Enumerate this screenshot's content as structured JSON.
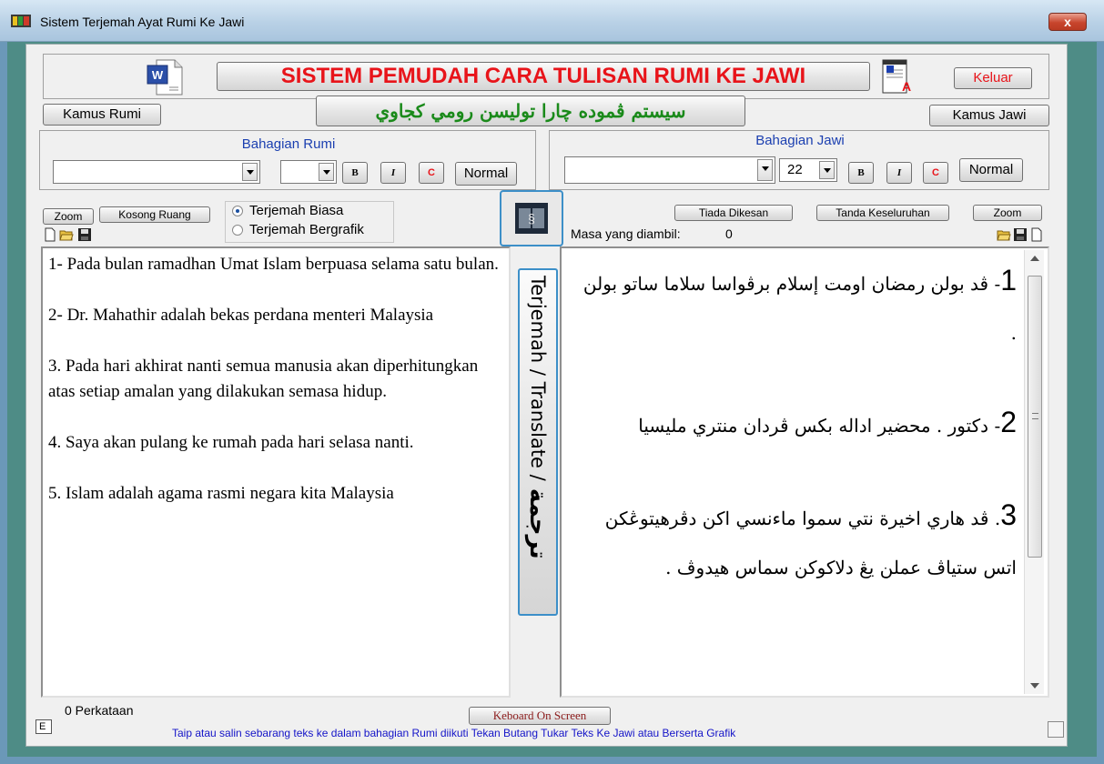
{
  "window": {
    "title": "Sistem Terjemah Ayat Rumi Ke Jawi",
    "close": "x"
  },
  "header": {
    "main_title": "SISTEM PEMUDAH CARA TULISAN RUMI KE JAWI",
    "jawi_title": "سيستم ڤموده چارا توليسن رومي كجاوي",
    "exit_button": "Keluar",
    "kamus_rumi": "Kamus Rumi",
    "kamus_jawi": "Kamus Jawi"
  },
  "rumi_panel": {
    "label": "Bahagian Rumi",
    "font_value": "",
    "size_value": "",
    "bold": "B",
    "italic": "I",
    "color": "C",
    "normal": "Normal"
  },
  "jawi_panel": {
    "label": "Bahagian Jawi",
    "font_value": "",
    "size_value": "22",
    "bold": "B",
    "italic": "I",
    "color": "C",
    "normal": "Normal"
  },
  "left_controls": {
    "zoom": "Zoom",
    "kosong": "Kosong Ruang",
    "radio_biasa": "Terjemah Biasa",
    "radio_grafik": "Terjemah Bergrafik",
    "selected": "biasa"
  },
  "right_controls": {
    "tiada": "Tiada Dikesan",
    "tanda": "Tanda Keseluruhan",
    "zoom": "Zoom",
    "masa_label": "Masa yang diambil:",
    "masa_value": "0"
  },
  "translate_button": {
    "latin": "Terjemah / Translate /",
    "jawi": "ترجمة"
  },
  "rumi_text": [
    "1- Pada bulan ramadhan Umat Islam berpuasa selama satu bulan.",
    "2- Dr. Mahathir adalah bekas perdana menteri Malaysia",
    "3. Pada hari akhirat nanti semua manusia akan diperhitungkan atas setiap amalan yang dilakukan semasa hidup.",
    " 4. Saya akan pulang ke rumah pada hari selasa nanti.",
    "5. Islam adalah agama rasmi negara kita Malaysia"
  ],
  "jawi_text": [
    {
      "num": "1",
      "text": "- ڤد بولن رمضان اومت إسلام برڤواسا سلاما ساتو بولن ."
    },
    {
      "num": "2",
      "text": "- دكتور . محضير اداله بكس ڤردان منتري مليسيا"
    },
    {
      "num": "3",
      "text": ". ڤد هاري اخيرة نتي سموا ماءنسي اكن دڤرهيتوڠكن اتس ستياڤ عملن يڠ دلاكوكن سماس هيدوڤ ."
    }
  ],
  "footer": {
    "word_count": "0 Perkataan",
    "keyboard": "Keboard  On Screen",
    "hint": "Taip atau salin sebarang teks ke dalam  bahagian Rumi diikuti Tekan Butang Tukar Teks Ke Jawi atau Berserta Grafik",
    "e_box": "E"
  },
  "colors": {
    "title_red": "#e8141a",
    "jawi_green": "#1a8a1a",
    "label_blue": "#1b3fb0",
    "hint_blue": "#1414c8"
  }
}
